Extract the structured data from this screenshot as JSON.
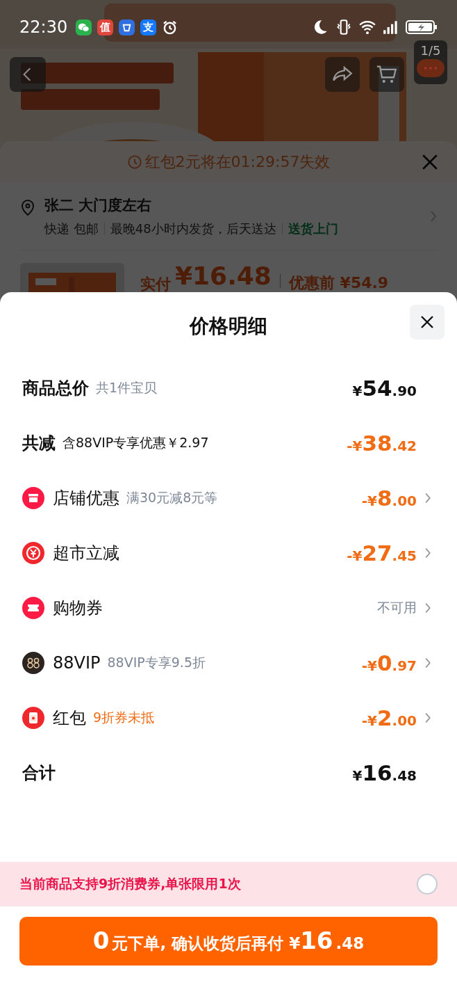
{
  "status_bar": {
    "time": "22:30",
    "notifications": [
      {
        "kind": "chat",
        "color": "#2bb24c"
      },
      {
        "kind": "glyph",
        "glyph": "值",
        "color": "#e0463c"
      },
      {
        "kind": "box",
        "color": "#2f6fe0"
      },
      {
        "kind": "glyph",
        "glyph": "支",
        "color": "#1677ff"
      },
      {
        "kind": "alarm",
        "color": "#ffffff"
      }
    ]
  },
  "gallery": {
    "counter": "1/5"
  },
  "order_sheet": {
    "timer": "红包2元将在01:29:57失效",
    "address": "张二 大门度左右",
    "delivery": [
      {
        "text": "快递 包邮",
        "highlight": false
      },
      {
        "text": "最晚48小时内发货，后天送达",
        "highlight": false
      },
      {
        "text": "送货上门",
        "highlight": true
      }
    ],
    "paid_label": "实付",
    "paid_amount": "¥16.48",
    "before_label": "优惠前 ¥54.9"
  },
  "price_detail": {
    "title": "价格明细",
    "rows": [
      {
        "kind": "header",
        "label": "商品总价",
        "note": "共1件宝贝",
        "amount": "¥54.90"
      },
      {
        "kind": "reduction",
        "label": "共减",
        "note": "含88VIP专享优惠￥2.97",
        "amount": "-¥38.42"
      },
      {
        "kind": "discount",
        "label": "店铺优惠",
        "note": "满30元减8元等",
        "note_highlight": false,
        "amount": "-¥8.00",
        "available": true
      },
      {
        "kind": "discount",
        "label": "超市立减",
        "amount": "-¥27.45",
        "available": true
      },
      {
        "kind": "discount",
        "label": "购物券",
        "amount": "不可用",
        "available": false
      },
      {
        "kind": "discount",
        "label": "88VIP",
        "note": "88VIP专享9.5折",
        "note_highlight": false,
        "amount": "-¥0.97",
        "available": true
      },
      {
        "kind": "discount",
        "label": "红包",
        "note": "9折券未抵",
        "note_highlight": true,
        "amount": "-¥2.00",
        "available": true
      },
      {
        "kind": "total",
        "label": "合计",
        "amount": "¥16.48"
      }
    ]
  },
  "coupon_banner": {
    "text": "当前商品支持9折消费券,单张限用1次",
    "checked": false
  },
  "submit_button": {
    "lead": "0",
    "label": "元下单, 确认收货后再付",
    "amount": "¥16.48"
  }
}
